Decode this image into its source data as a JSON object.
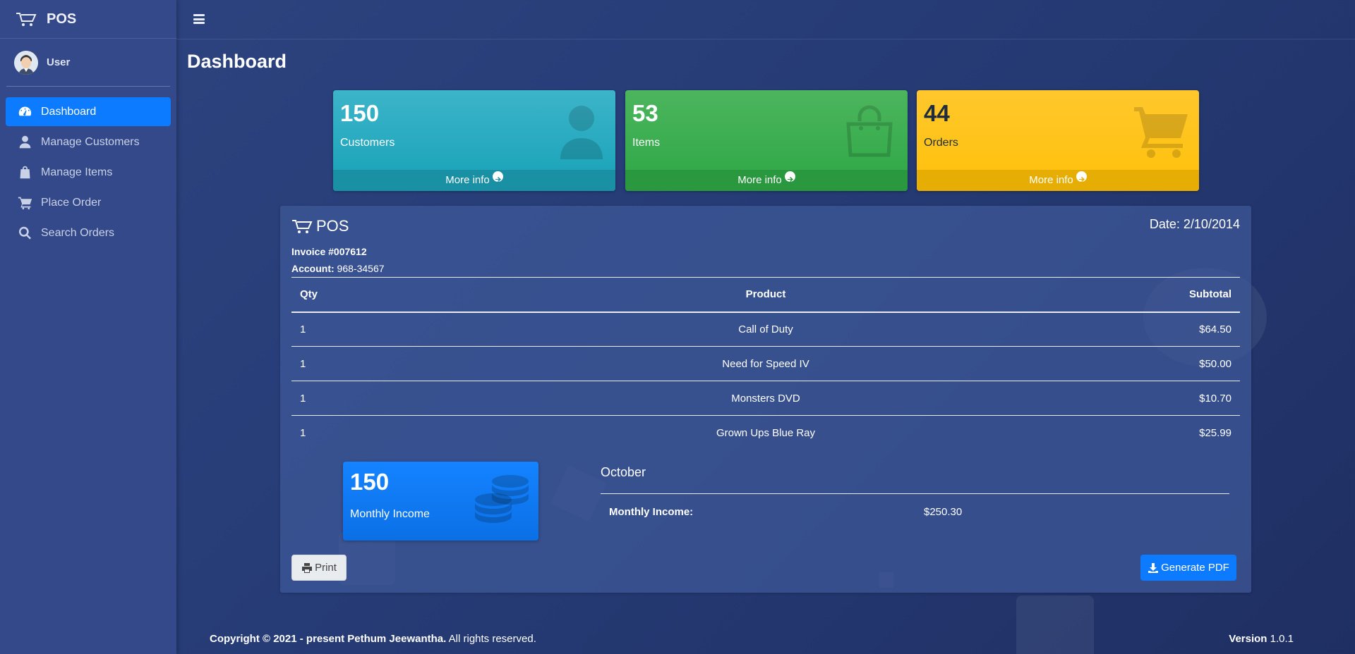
{
  "app": {
    "brand": "POS"
  },
  "user": {
    "name": "User"
  },
  "sidebar": {
    "items": [
      {
        "label": "Dashboard",
        "icon": "tachometer-icon",
        "active": true
      },
      {
        "label": "Manage Customers",
        "icon": "user-icon"
      },
      {
        "label": "Manage Items",
        "icon": "shopping-bag-icon"
      },
      {
        "label": "Place Order",
        "icon": "shopping-cart-icon"
      },
      {
        "label": "Search Orders",
        "icon": "search-icon"
      }
    ]
  },
  "page": {
    "title": "Dashboard"
  },
  "stats": [
    {
      "value": "150",
      "label": "Customers",
      "more": "More info",
      "color": "#17a2b8",
      "icon": "user-icon"
    },
    {
      "value": "53",
      "label": "Items",
      "more": "More info",
      "color": "#28a745",
      "icon": "shopping-bag-icon"
    },
    {
      "value": "44",
      "label": "Orders",
      "more": "More info",
      "color": "#ffc107",
      "icon": "shopping-cart-icon"
    }
  ],
  "invoice": {
    "brand": "POS",
    "date": "Date: 2/10/2014",
    "number": "Invoice #007612",
    "account_label": "Account:",
    "account_value": " 968-34567",
    "headers": {
      "qty": "Qty",
      "product": "Product",
      "subtotal": "Subtotal"
    },
    "rows": [
      {
        "qty": "1",
        "product": "Call of Duty",
        "subtotal": "$64.50"
      },
      {
        "qty": "1",
        "product": "Need for Speed IV",
        "subtotal": "$50.00"
      },
      {
        "qty": "1",
        "product": "Monsters DVD",
        "subtotal": "$10.70"
      },
      {
        "qty": "1",
        "product": "Grown Ups Blue Ray",
        "subtotal": "$25.99"
      }
    ],
    "income_box": {
      "value": "150",
      "label": "Monthly Income",
      "color": "#007bff",
      "icon": "coins-icon"
    },
    "month": "October",
    "monthly_income_label": "Monthly Income:",
    "monthly_income_value": "$250.30",
    "print_label": "Print",
    "pdf_label": "Generate PDF"
  },
  "footer": {
    "copyright_bold": "Copyright © 2021 - present Pethum Jeewantha.",
    "copyright_rest": " All rights reserved.",
    "version_label": "Version",
    "version_value": " 1.0.1"
  }
}
